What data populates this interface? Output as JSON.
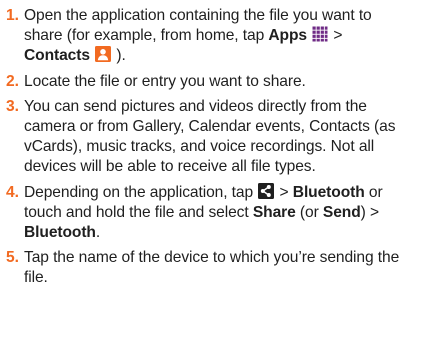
{
  "steps": [
    {
      "num": "1.",
      "t1": "Open the application containing the file you want to share (for example, from home, tap ",
      "apps": "Apps",
      "t2": " > ",
      "contacts": "Contacts",
      "t3": " )."
    },
    {
      "num": "2.",
      "text": "Locate the file or entry you want to share."
    },
    {
      "num": "3.",
      "text": "You can send pictures and videos directly from the camera or from Gallery, Calendar events, Contacts (as vCards), music tracks, and voice recordings. Not all devices will be able to receive all file types."
    },
    {
      "num": "4.",
      "t1": "Depending on the application, tap ",
      "t2": " > ",
      "bluetooth": "Bluetooth",
      "t3": " or touch and hold the file and select ",
      "share": "Share",
      "t4": " (or ",
      "send": "Send",
      "t5": ") > ",
      "bluetooth2": "Bluetooth",
      "t6": "."
    },
    {
      "num": "5.",
      "text": "Tap the name of the device to which you’re sending the file."
    }
  ],
  "icons": {
    "apps": "apps-grid-icon",
    "contacts": "contacts-icon",
    "share": "share-icon"
  },
  "colors": {
    "number": "#f26a21",
    "contacts_icon": "#f26a21",
    "apps_icon": "#6f2b86",
    "share_icon": "#1f1f1f"
  }
}
